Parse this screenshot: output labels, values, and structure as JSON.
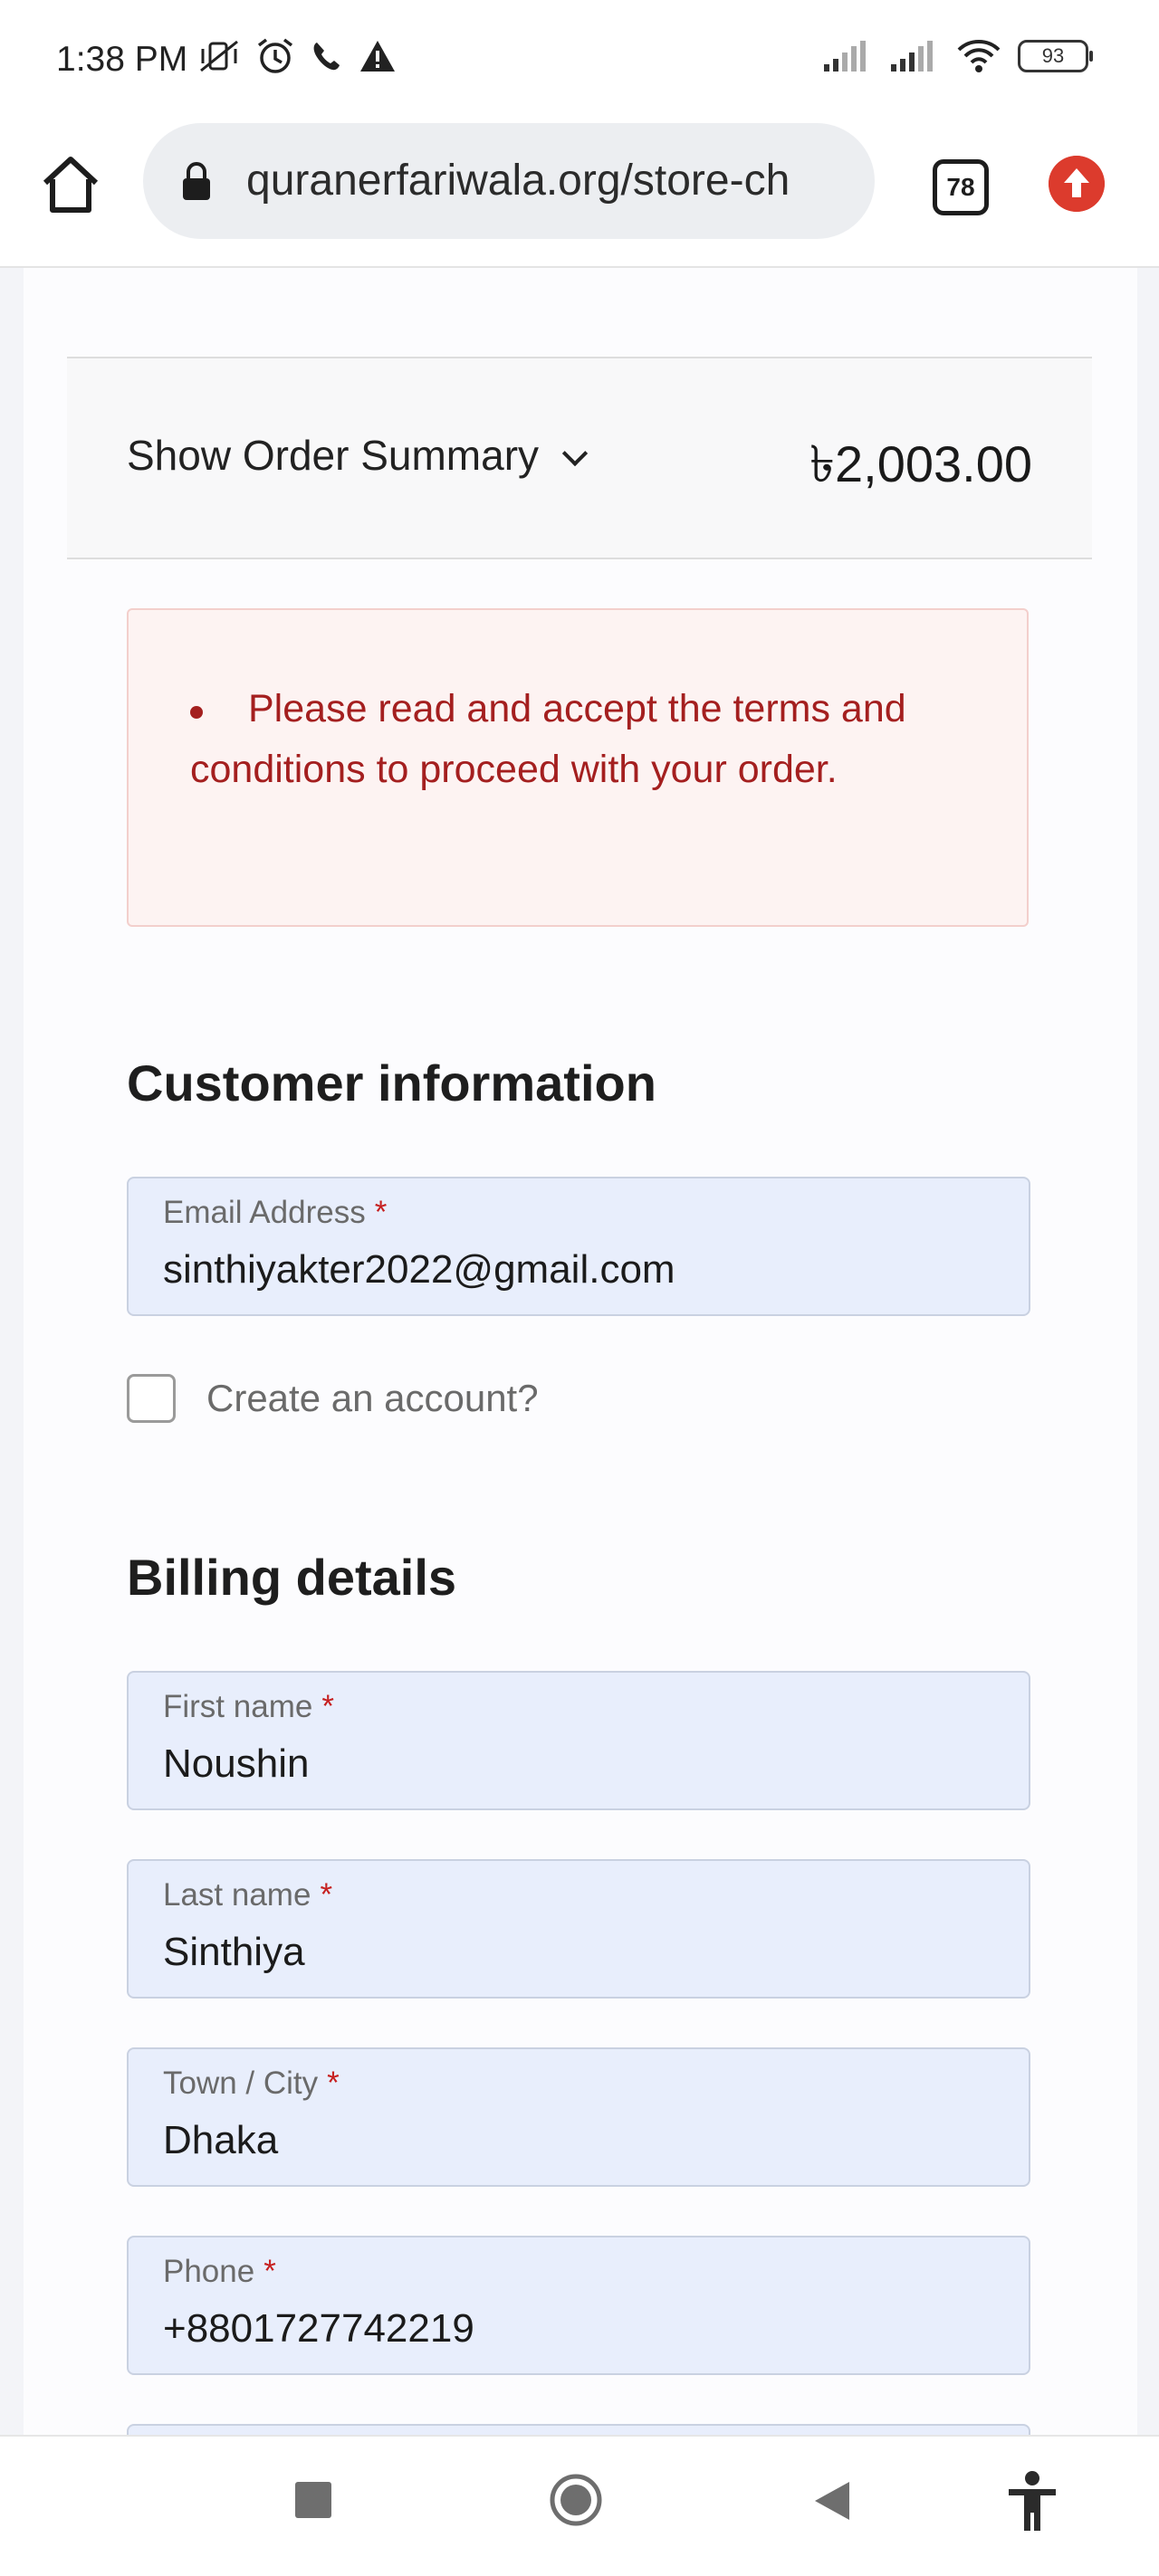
{
  "status_bar": {
    "time": "1:38 PM",
    "battery": "93"
  },
  "browser": {
    "url": "quranerfariwala.org/store-ch",
    "tab_count": "78"
  },
  "order_summary": {
    "toggle_label": "Show Order Summary",
    "total": "৳2,003.00"
  },
  "notice": {
    "message": "Please read and accept the terms and conditions to proceed with your order."
  },
  "customer_info": {
    "heading": "Customer information",
    "email_label": "Email Address",
    "email_value": "sinthiyakter2022@gmail.com",
    "create_account_label": "Create an account?"
  },
  "billing": {
    "heading": "Billing details",
    "fields": [
      {
        "label": "First name",
        "value": "Noushin"
      },
      {
        "label": "Last name",
        "value": "Sinthiya"
      },
      {
        "label": "Town / City",
        "value": "Dhaka"
      },
      {
        "label": "Phone",
        "value": "+8801727742219"
      }
    ]
  },
  "required_marker": "*",
  "colors": {
    "error_text": "#a41f1f",
    "notice_bg": "#fdf3f2",
    "field_bg": "#e8eefc",
    "update_badge": "#dc3b2d"
  },
  "icons": {
    "home": "home-icon",
    "lock": "lock-icon",
    "tabs": "tabs-icon",
    "update": "update-arrow-icon",
    "nav_recent": "square-icon",
    "nav_home": "circle-icon",
    "nav_back": "triangle-back-icon",
    "accessibility": "accessibility-icon"
  }
}
